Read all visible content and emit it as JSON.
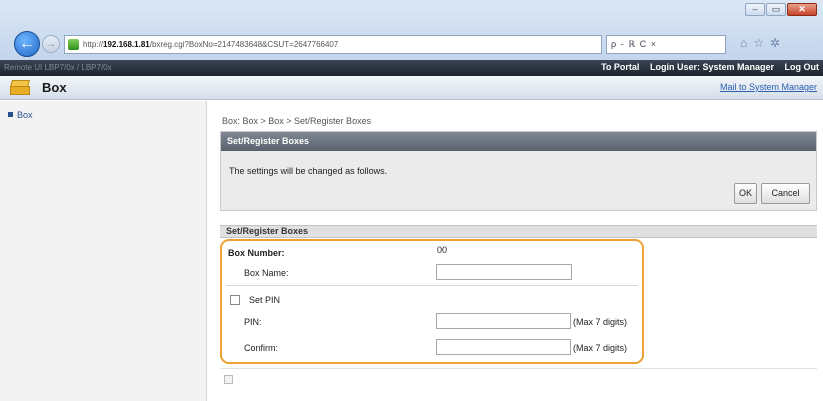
{
  "browser": {
    "url_prefix": "http://",
    "url_host": "192.168.1.81",
    "url_rest": "/bxreg.cgi?BoxNo=2147483648&CSUT=2647766407",
    "search_tools": "ρ - ℝ C ×",
    "back_glyph": "←",
    "forward_glyph": "→",
    "window_buttons": [
      "–",
      "▭",
      "✕"
    ],
    "toolbar_icons": [
      "home-icon",
      "star-icon",
      "gear-icon"
    ],
    "toolbar_glyphs": [
      "⌂",
      "☆",
      "✲"
    ]
  },
  "topbar": {
    "ghost_text": "Remote UI        LBP7/0x / LBP7/0x",
    "to_portal": "To Portal",
    "login_user": "Login User: System Manager",
    "log_out": "Log Out"
  },
  "header": {
    "title": "Box",
    "mailto": "Mail to System Manager",
    "icon": "box-icon"
  },
  "sidebar": {
    "items": [
      {
        "label": "Box"
      }
    ]
  },
  "breadcrumb": "Box: Box > Box > Set/Register Boxes",
  "confirm_section": {
    "title": "Set/Register Boxes",
    "message": "The settings will be changed as follows.",
    "ok_label": "OK",
    "cancel_label": "Cancel"
  },
  "details_section": {
    "title": "Set/Register Boxes",
    "box_number_label": "Box Number:",
    "box_number_value": "00",
    "box_name_label": "Box Name:",
    "box_name_value": "",
    "set_pin_label": "Set PIN",
    "set_pin_checked": false,
    "pin_label": "PIN:",
    "pin_hint": "(Max 7 digits)",
    "confirm_label": "Confirm:",
    "confirm_hint": "(Max 7 digits)"
  },
  "colors": {
    "highlight": "#f0a032",
    "section_header": "#5a626d",
    "topbar": "#1c232c"
  }
}
